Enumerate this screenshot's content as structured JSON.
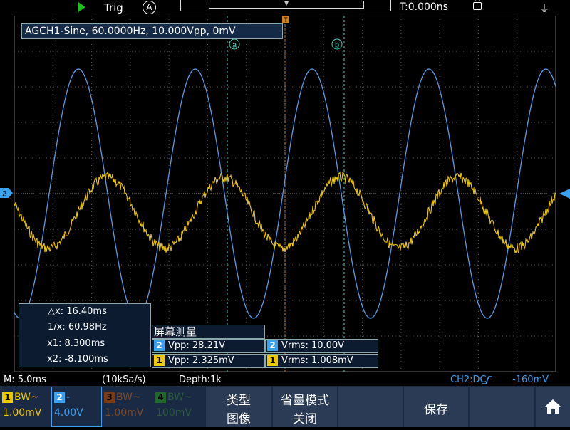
{
  "topbar": {
    "trigger_label": "Trig",
    "trigger_mode_icon": "A",
    "time_position": "T:0.000ns",
    "run_icon": "play-icon",
    "usb_icon": "usb-icon",
    "lock_icon": "lock-icon"
  },
  "signal_info": "AGCH1-Sine, 60.0000Hz, 10.000Vpp, 0mV",
  "markers": {
    "trigger": "T",
    "cursor_a": "a",
    "cursor_b": "b",
    "ch2_level": "2"
  },
  "cursor_panel": {
    "dx": "△x: 16.40ms",
    "inv_dx": "1/x: 60.98Hz",
    "x1": "x1: 8.300ms",
    "x2": "x2: -8.100ms"
  },
  "measure": {
    "title": "屏幕测量",
    "ch2_vpp": "Vpp: 28.21V",
    "ch2_vrms": "Vrms: 10.00V",
    "ch1_vpp": "Vpp: 2.325mV",
    "ch1_vrms": "Vrms: 1.008mV",
    "ch1_badge": "1",
    "ch2_badge": "2"
  },
  "statusbar": {
    "timebase": "M: 5.0ms",
    "sample_rate": "(10kSa/s)",
    "depth": "Depth:1k",
    "trigger_status": "CH2:DC",
    "trigger_level": "-160mV"
  },
  "channels": [
    {
      "num": "1",
      "coupling": "BW~",
      "scale": "1.00mV",
      "color": "#f0c800"
    },
    {
      "num": "2",
      "coupling": "-",
      "scale": "4.00V",
      "color": "#3aa0f0"
    },
    {
      "num": "3",
      "coupling": "BW~",
      "scale": "1.00mV",
      "color": "#b05a20"
    },
    {
      "num": "4",
      "coupling": "BW~",
      "scale": "100mV",
      "color": "#2a9a3a"
    }
  ],
  "softkeys": {
    "type_label": "类型",
    "type_value": "图像",
    "ink_label": "省墨模式",
    "ink_value": "关闭",
    "save_label": "保存",
    "home_icon": "home-icon"
  },
  "colors": {
    "ch1": "#f0c800",
    "ch2": "#5a9ae6",
    "cursor": "#4ad0c0",
    "grid": "#5a5a5a"
  }
}
